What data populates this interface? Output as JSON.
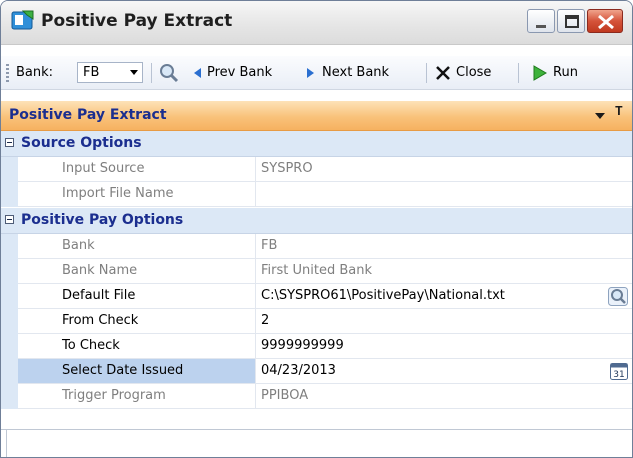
{
  "window": {
    "title": "Positive Pay Extract",
    "icon": "app-icon",
    "controls": {
      "minimize": "minimize-icon",
      "maximize": "maximize-icon",
      "close": "close-icon"
    }
  },
  "toolbar": {
    "bank_label": "Bank:",
    "bank_value": "FB",
    "prev_label": "Prev Bank",
    "next_label": "Next Bank",
    "close_label": "Close",
    "run_label": "Run"
  },
  "panel": {
    "title": "Positive Pay Extract"
  },
  "sections": [
    {
      "title": "Source Options",
      "rows": [
        {
          "name": "Input Source",
          "value": "SYSPRO",
          "editable": false
        },
        {
          "name": "Import File Name",
          "value": "",
          "editable": false
        }
      ]
    },
    {
      "title": "Positive Pay Options",
      "rows": [
        {
          "name": "Bank",
          "value": "FB",
          "editable": false
        },
        {
          "name": "Bank Name",
          "value": "First United Bank",
          "editable": false
        },
        {
          "name": "Default File",
          "value": "C:\\SYSPRO61\\PositivePay\\National.txt",
          "editable": true
        },
        {
          "name": "From Check",
          "value": "2",
          "editable": true
        },
        {
          "name": "To Check",
          "value": "9999999999",
          "editable": true
        },
        {
          "name": "Select Date Issued",
          "value": "04/23/2013",
          "editable": true,
          "selected": true
        },
        {
          "name": "Trigger Program",
          "value": "PPIBOA",
          "editable": false
        }
      ]
    }
  ],
  "calendar_icon_text": "31",
  "colors": {
    "category_text": "#1b2e8f",
    "panel_header": "#f9c27a",
    "selected_row": "#bcd2ee",
    "readonly_text": "#7f7f7f"
  }
}
